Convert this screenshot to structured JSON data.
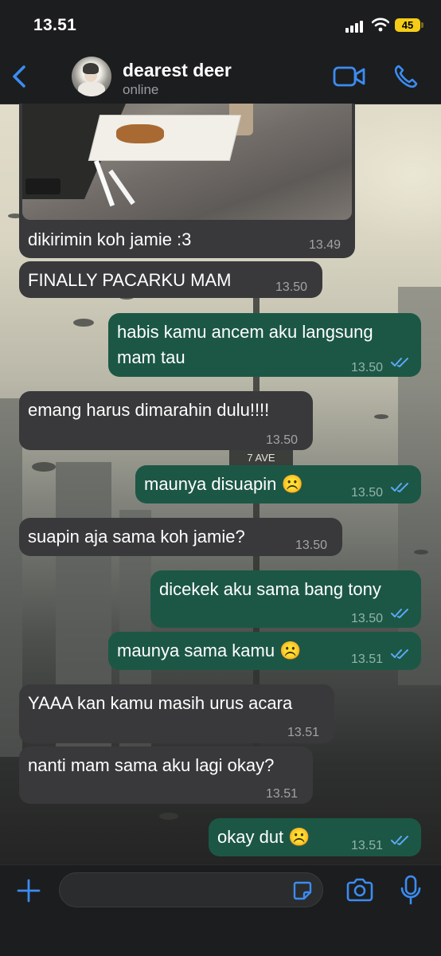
{
  "status_bar": {
    "time": "13.51",
    "battery": "45"
  },
  "header": {
    "contact_name": "dearest deer",
    "contact_status": "online"
  },
  "wallpaper": {
    "street_sign": "7 AVE"
  },
  "messages": [
    {
      "direction": "in",
      "text": "dikirimin koh jamie :3",
      "time": "13.49",
      "has_photo": true
    },
    {
      "direction": "in",
      "text": "FINALLY PACARKU MAM",
      "time": "13.50"
    },
    {
      "direction": "out",
      "text_line1": "habis kamu ancem aku langsung",
      "text_line2": "mam tau",
      "time": "13.50",
      "read": true
    },
    {
      "direction": "in",
      "text": "emang harus dimarahin dulu!!!!",
      "time": "13.50"
    },
    {
      "direction": "out",
      "text": "maunya disuapin ☹️",
      "time": "13.50",
      "read": true
    },
    {
      "direction": "in",
      "text": "suapin aja sama koh jamie?",
      "time": "13.50"
    },
    {
      "direction": "out",
      "text": "dicekek aku sama bang tony",
      "time": "13.50",
      "read": true
    },
    {
      "direction": "out",
      "text": "maunya sama kamu ☹️",
      "time": "13.51",
      "read": true
    },
    {
      "direction": "in",
      "text": "YAAA kan kamu masih urus acara",
      "time": "13.51"
    },
    {
      "direction": "in",
      "text": "nanti mam sama aku lagi okay?",
      "time": "13.51"
    },
    {
      "direction": "out",
      "text": "okay dut ☹️",
      "time": "13.51",
      "read": true
    }
  ],
  "input_bar": {
    "placeholder": "",
    "value": ""
  },
  "colors": {
    "accent": "#3b8cf0",
    "incoming_bubble": "#39393b",
    "outgoing_bubble": "#1c5745",
    "read_check": "#5aa8f5",
    "battery": "#f5cc17"
  },
  "icons": [
    "back-chevron-icon",
    "video-call-icon",
    "phone-icon",
    "plus-icon",
    "sticker-icon",
    "camera-icon",
    "microphone-icon",
    "double-check-icon"
  ]
}
